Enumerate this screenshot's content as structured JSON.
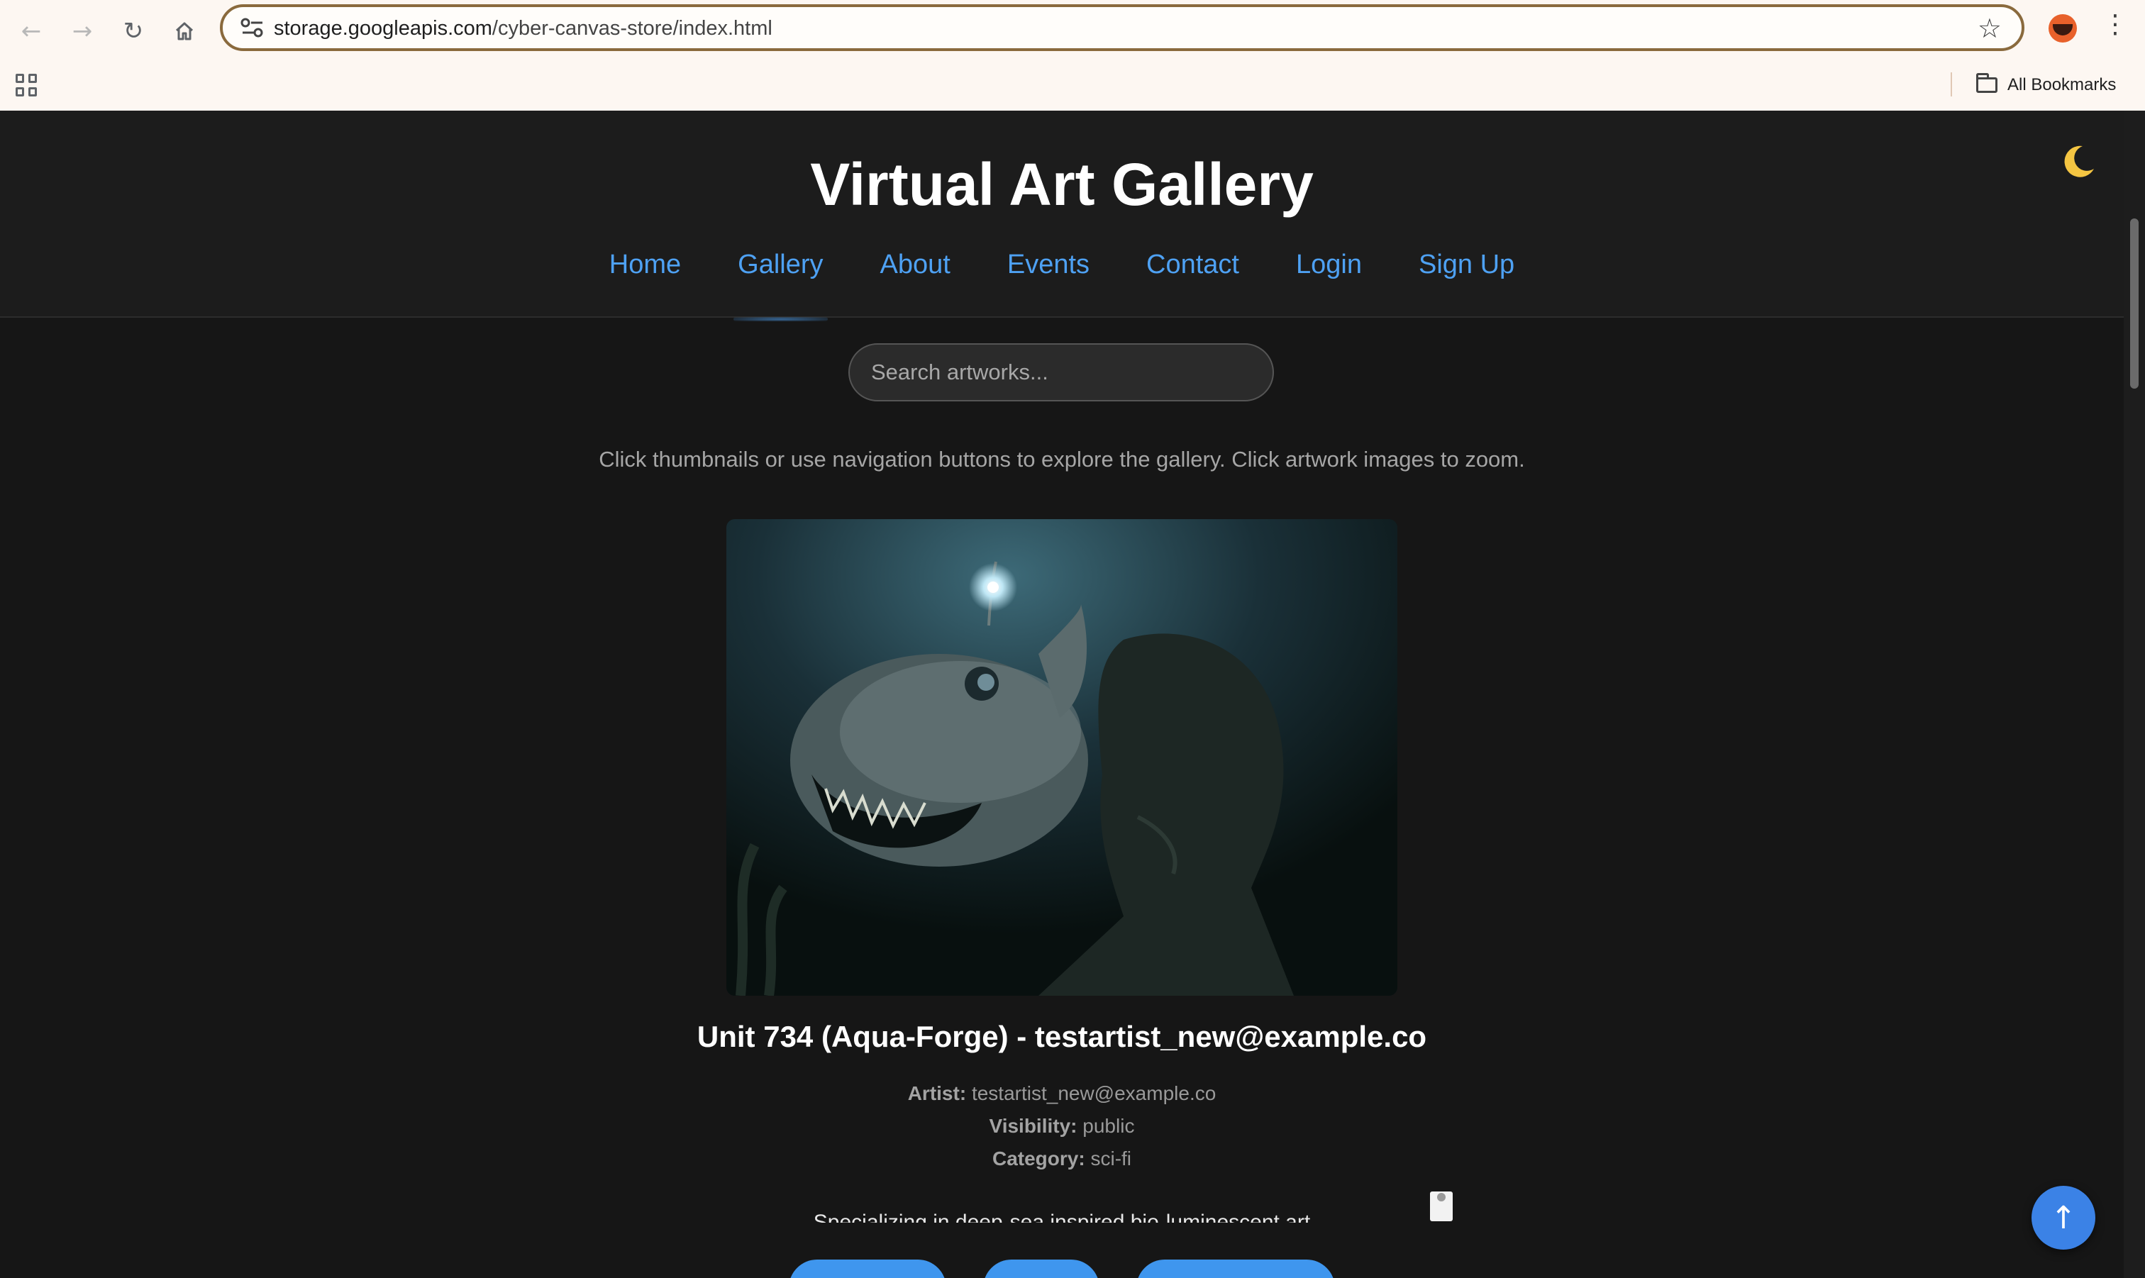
{
  "browser": {
    "url_domain": "storage.googleapis.com",
    "url_path": "/cyber-canvas-store/index.html",
    "bookmarks_label": "All Bookmarks",
    "icons": [
      "back-icon",
      "forward-icon",
      "reload-icon",
      "home-icon",
      "site-info-icon",
      "star-icon",
      "profile-avatar",
      "menu-icon",
      "apps-icon",
      "folder-icon"
    ]
  },
  "site": {
    "title": "Virtual Art Gallery",
    "theme_icon": "moon-icon",
    "nav": [
      {
        "label": "Home"
      },
      {
        "label": "Gallery"
      },
      {
        "label": "About"
      },
      {
        "label": "Events"
      },
      {
        "label": "Contact"
      },
      {
        "label": "Login"
      },
      {
        "label": "Sign Up"
      }
    ],
    "active_nav": "Gallery"
  },
  "search": {
    "placeholder": "Search artworks..."
  },
  "hint": "Click thumbnails or use navigation buttons to explore the gallery. Click artwork images to zoom.",
  "artwork": {
    "title": "Unit 734 (Aqua-Forge) - testartist_new@example.co",
    "artist_label": "Artist:",
    "artist": "testartist_new@example.co",
    "visibility_label": "Visibility:",
    "visibility": "public",
    "category_label": "Category:",
    "category": "sci-fi",
    "description": "Specializing in deep-sea inspired bio-luminescent art"
  },
  "scroll_top_glyph": "↑",
  "colors": {
    "accent": "#4ea1f3",
    "button": "#3f96ee",
    "background": "#161616",
    "header": "#1c1c1c",
    "omnibox_border": "#8a6a3d"
  }
}
